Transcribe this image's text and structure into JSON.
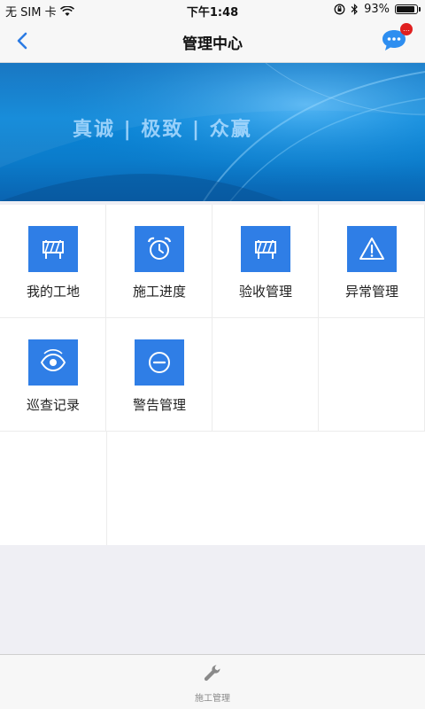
{
  "status_bar": {
    "carrier": "无 SIM 卡",
    "time": "下午1:48",
    "battery_percent": "93%",
    "battery_level": 0.93
  },
  "nav": {
    "title": "管理中心",
    "back_icon": "chevron-left-icon",
    "message_icon": "chat-bubble-icon",
    "message_badge": "…"
  },
  "banner": {
    "slogan": "真诚 | 极致 | 众赢"
  },
  "menu": [
    {
      "label": "我的工地",
      "icon": "construction-barrier-icon"
    },
    {
      "label": "施工进度",
      "icon": "alarm-clock-icon"
    },
    {
      "label": "验收管理",
      "icon": "construction-barrier-icon"
    },
    {
      "label": "异常管理",
      "icon": "warning-icon"
    },
    {
      "label": "巡查记录",
      "icon": "eye-icon"
    },
    {
      "label": "警告管理",
      "icon": "minus-circle-icon"
    }
  ],
  "tab_bar": {
    "items": [
      {
        "label": "施工管理",
        "icon": "wrench-icon"
      }
    ]
  },
  "colors": {
    "accent": "#2f7ee6",
    "banner_blue": "#0a86d8",
    "badge_red": "#e02020"
  }
}
